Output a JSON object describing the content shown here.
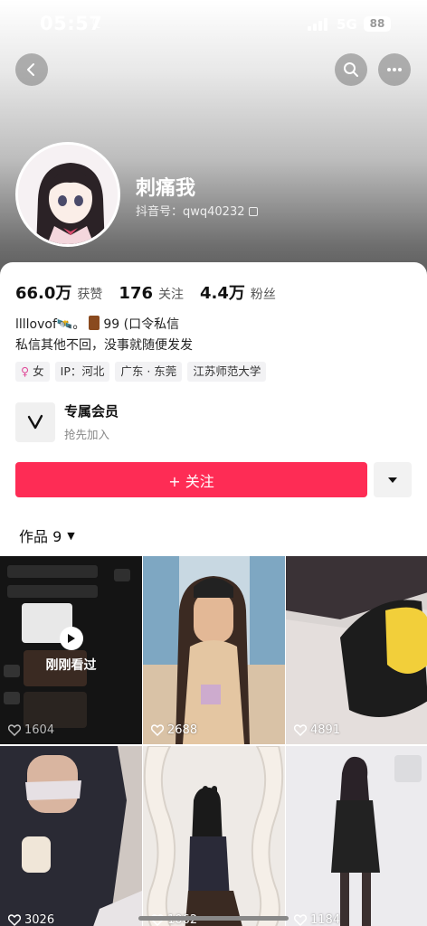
{
  "status_bar": {
    "time": "05:57",
    "network": "5G",
    "battery": "88"
  },
  "profile": {
    "username": "刺痛我",
    "douyin_id": "抖音号：qwq40232"
  },
  "stats": [
    {
      "value": "66.0万",
      "label": "获赞"
    },
    {
      "value": "176",
      "label": "关注"
    },
    {
      "value": "4.4万",
      "label": "粉丝"
    }
  ],
  "bio": {
    "line1_a": "llllovof🛰️。",
    "line1_b": "99 (口令私信",
    "line2": "私信其他不回，没事就随便发发"
  },
  "tags": [
    {
      "icon": "female-icon",
      "text": "女"
    },
    {
      "text": "IP：河北"
    },
    {
      "text": "广东 · 东莞"
    },
    {
      "text": "江苏师范大学"
    }
  ],
  "member": {
    "title": "专属会员",
    "subtitle": "抢先加入"
  },
  "follow_button": "+ 关注",
  "works_tab": "作品 9",
  "videos": [
    {
      "likes": "1604",
      "watched": "刚刚看过"
    },
    {
      "likes": "2688"
    },
    {
      "likes": "4891"
    },
    {
      "likes": "3026"
    },
    {
      "likes": "1062"
    },
    {
      "likes": "1184"
    }
  ],
  "colors": {
    "accent": "#fe2c55",
    "tag_bg": "#f2f2f4"
  }
}
